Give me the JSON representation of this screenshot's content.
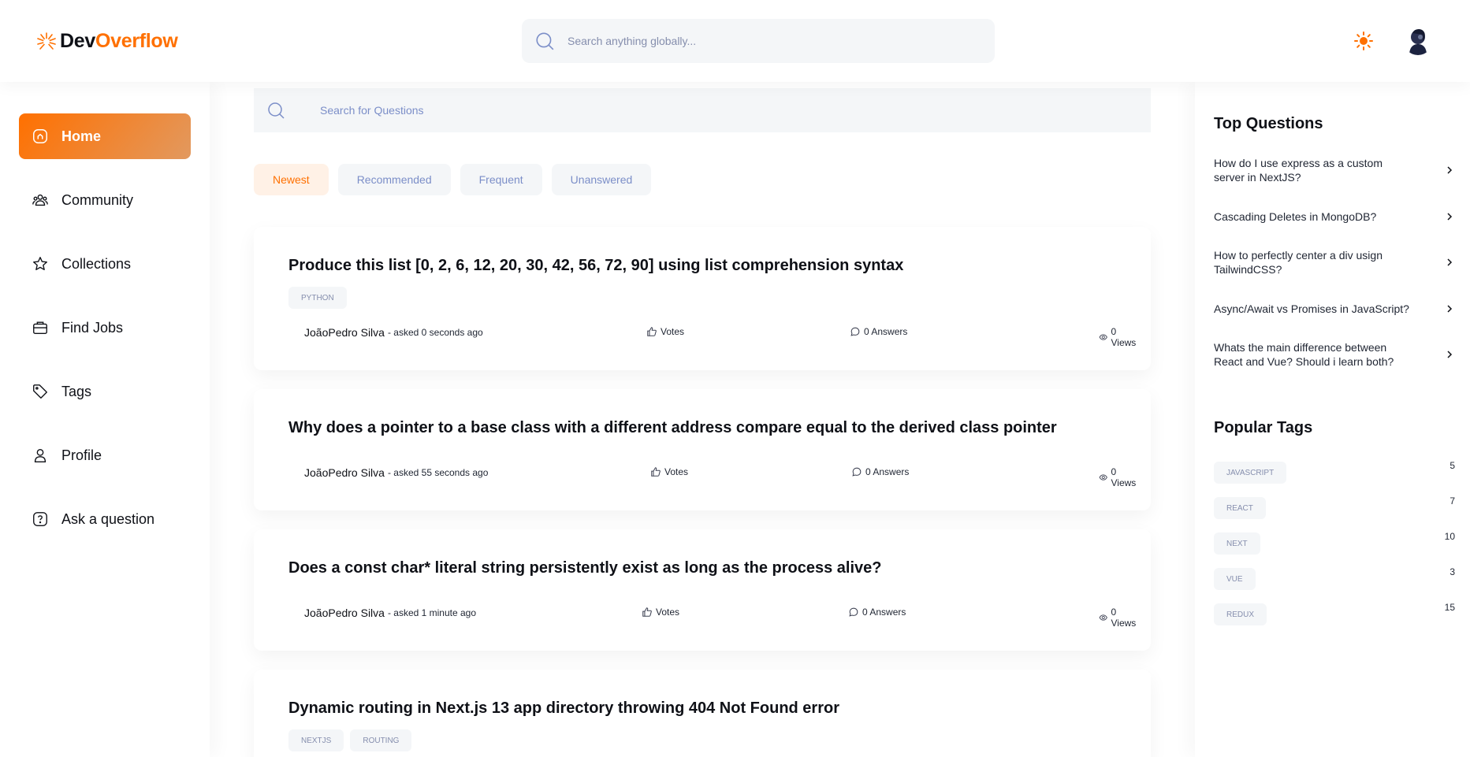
{
  "brand": {
    "prefix": "Dev",
    "suffix": "Overflow",
    "accent": "#ff7000"
  },
  "global_search": {
    "placeholder": "Search anything globally..."
  },
  "sidebar": {
    "items": [
      {
        "label": "Home",
        "icon": "home-icon",
        "active": true
      },
      {
        "label": "Community",
        "icon": "users-icon"
      },
      {
        "label": "Collections",
        "icon": "star-icon"
      },
      {
        "label": "Find Jobs",
        "icon": "suitcase-icon"
      },
      {
        "label": "Tags",
        "icon": "tag-icon"
      },
      {
        "label": "Profile",
        "icon": "user-icon"
      },
      {
        "label": "Ask a question",
        "icon": "question-icon"
      }
    ]
  },
  "local_search": {
    "placeholder": "Search for Questions"
  },
  "filters": [
    "Newest",
    "Recommended",
    "Frequent",
    "Unanswered"
  ],
  "questions": [
    {
      "title": "Produce this list [0, 2, 6, 12, 20, 30, 42, 56, 72, 90] using list comprehension syntax",
      "tags": [
        "PYTHON"
      ],
      "author": "JoãoPedro Silva",
      "asked": "- asked 0 seconds ago",
      "votes": "Votes",
      "answers": "0 Answers",
      "views": "0 Views"
    },
    {
      "title": "Why does a pointer to a base class with a different address compare equal to the derived class pointer",
      "tags": [],
      "author": "JoãoPedro Silva",
      "asked": "- asked 55 seconds ago",
      "votes": "Votes",
      "answers": "0 Answers",
      "views": "0 Views"
    },
    {
      "title": "Does a const char* literal string persistently exist as long as the process alive?",
      "tags": [],
      "author": "JoãoPedro Silva",
      "asked": "- asked 1 minute ago",
      "votes": "Votes",
      "answers": "0 Answers",
      "views": "0 Views"
    },
    {
      "title": "Dynamic routing in Next.js 13 app directory throwing 404 Not Found error",
      "tags": [
        "NEXTJS",
        "ROUTING"
      ]
    }
  ],
  "right_sidebar": {
    "top_questions_heading": "Top Questions",
    "top_questions": [
      "How do I use express as a custom server in NextJS?",
      "Cascading Deletes in MongoDB?",
      "How to perfectly center a div usign TailwindCSS?",
      "Async/Await vs Promises in JavaScript?",
      "Whats the main difference between React and Vue? Should i learn both?"
    ],
    "popular_tags_heading": "Popular Tags",
    "popular_tags": [
      {
        "name": "JAVASCRIPT",
        "count": "5"
      },
      {
        "name": "REACT",
        "count": "7"
      },
      {
        "name": "NEXT",
        "count": "10"
      },
      {
        "name": "VUE",
        "count": "3"
      },
      {
        "name": "REDUX",
        "count": "15"
      }
    ]
  }
}
